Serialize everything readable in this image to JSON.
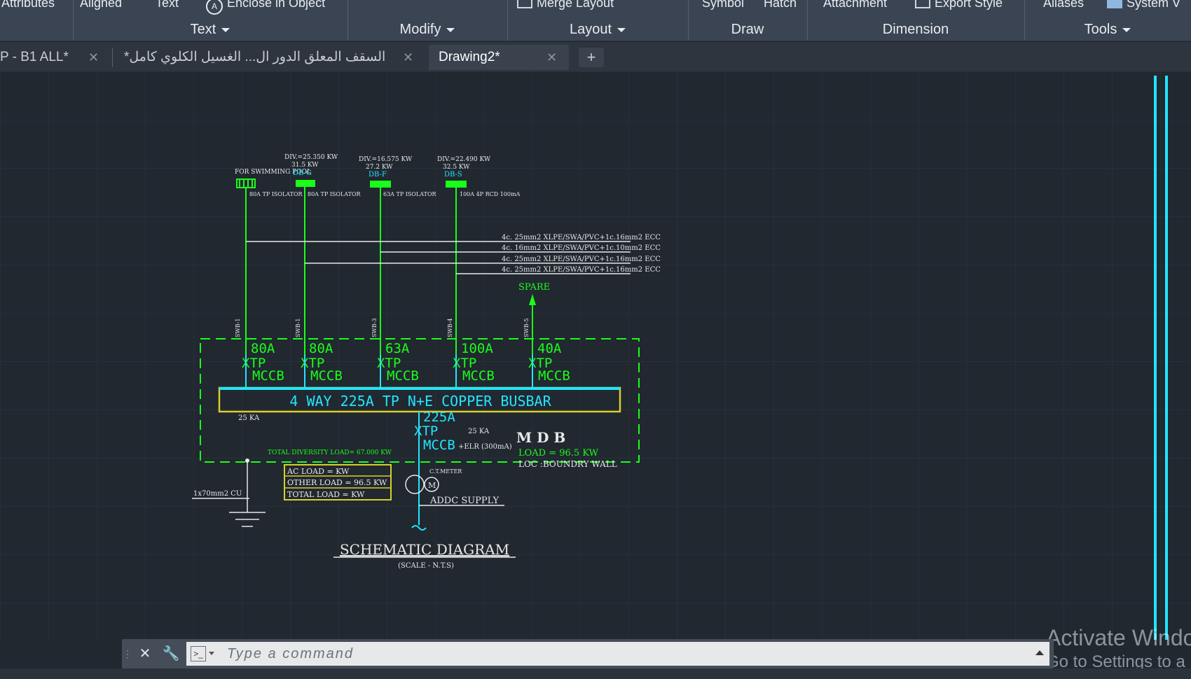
{
  "ribbon": {
    "top_items": {
      "attributes": "Attributes",
      "aligned": "Aligned",
      "text": "Text",
      "enclose": "Enclose in Object",
      "merge_layout": "Merge Layout",
      "symbol": "Symbol",
      "hatch": "Hatch",
      "attachment": "Attachment",
      "export_style": "Export Style",
      "aliases": "Aliases",
      "system": "System V"
    },
    "groups": {
      "text": "Text",
      "modify": "Modify",
      "layout": "Layout",
      "draw": "Draw",
      "dimension": "Dimension",
      "tools": "Tools"
    }
  },
  "tabs": [
    {
      "label": "P - B1 ALL*"
    },
    {
      "label": "السقف المعلق الدور ال... الغسيل الكلوي كامل*"
    },
    {
      "label": "Drawing2*"
    }
  ],
  "command_line": {
    "placeholder": "Type  a  command"
  },
  "watermark": {
    "line1": "Activate Windo",
    "line2": "Go to Settings to a"
  },
  "drawing": {
    "colors": {
      "green": "#19ff19",
      "cyan": "#22e5ff",
      "white": "#e8e8e8",
      "yellow": "#d8cf2a",
      "grid": "#2c3440",
      "background": "#212830"
    },
    "loads_top": [
      {
        "div": "DIV.=25.350 KW",
        "kw": "31.5 KW",
        "db": "DB-G"
      },
      {
        "div": "DIV.=16.575 KW",
        "kw": "27.2 KW",
        "db": "DB-F"
      },
      {
        "div": "DIV.=22.490 KW",
        "kw": "32.5 KW",
        "db": "DB-S"
      }
    ],
    "pool_label": "FOR SWIMMING POOL",
    "isolators": [
      "80A TP ISOLATOR",
      "80A TP ISOLATOR",
      "63A TP ISOLATOR",
      "100A 4P RCD 100mA"
    ],
    "cables": [
      "4c. 25mm2 XLPE/SWA/PVC+1c.16mm2 ECC",
      "4c. 16mm2 XLPE/SWA/PVC+1c.10mm2 ECC",
      "4c. 25mm2 XLPE/SWA/PVC+1c.16mm2 ECC",
      "4c. 25mm2 XLPE/SWA/PVC+1c.16mm2 ECC"
    ],
    "spare": "SPARE",
    "cable_tags": [
      "SWB-1",
      "SWB-1",
      "SWB-3",
      "SWB-4",
      "SWB-5"
    ],
    "breakers": [
      {
        "rating": "80A",
        "pole": "XTP",
        "type": "MCCB"
      },
      {
        "rating": "80A",
        "pole": "XTP",
        "type": "MCCB"
      },
      {
        "rating": "63A",
        "pole": "XTP",
        "type": "MCCB"
      },
      {
        "rating": "100A",
        "pole": "XTP",
        "type": "MCCB"
      },
      {
        "rating": "40A",
        "pole": "XTP",
        "type": "MCCB"
      }
    ],
    "busbar": "4  WAY  225A  TP  N+E  COPPER  BUSBAR",
    "fault_ka": "25 KA",
    "incomer": {
      "rating": "225A",
      "pole": "XTP",
      "type": "MCCB",
      "elr": "+ELR (300mA)",
      "ka": "25 KA"
    },
    "mdb": {
      "name": "M D B",
      "load": "LOAD = 96.5 KW",
      "loc": "LOC :BOUNDRY WALL"
    },
    "total_diversity": "TOTAL DIVERSITY LOAD= 67.000 KW",
    "load_table": [
      "AC LOAD    =  KW",
      "OTHER LOAD = 96.5 KW",
      "TOTAL LOAD =  KW"
    ],
    "earth": "1x70mm2 CU",
    "ct_meter": "C.T.METER",
    "meter_symbol": "M",
    "supply": "ADDC  SUPPLY",
    "title": "SCHEMATIC  DIAGRAM",
    "scale": "(SCALE - N.T.S)"
  }
}
